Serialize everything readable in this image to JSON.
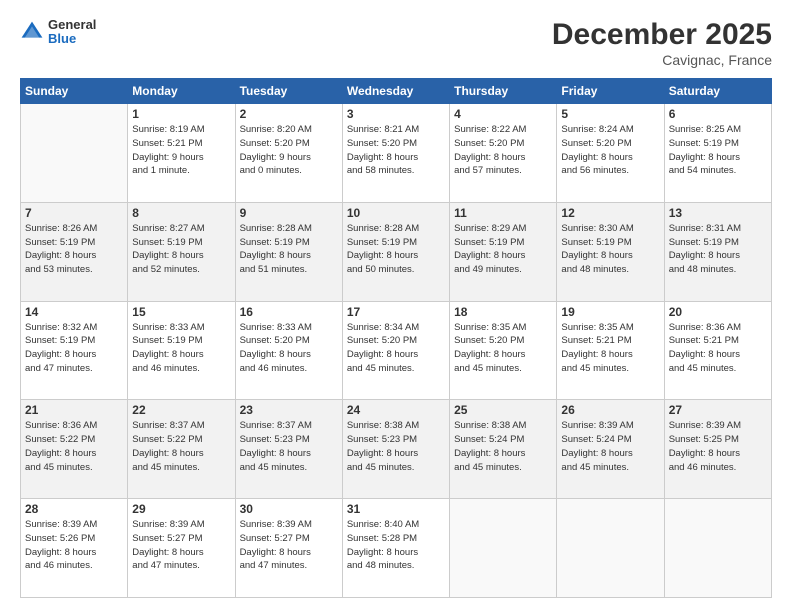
{
  "header": {
    "logo_general": "General",
    "logo_blue": "Blue",
    "main_title": "December 2025",
    "subtitle": "Cavignac, France"
  },
  "weekdays": [
    "Sunday",
    "Monday",
    "Tuesday",
    "Wednesday",
    "Thursday",
    "Friday",
    "Saturday"
  ],
  "weeks": [
    [
      {
        "day": "",
        "info": ""
      },
      {
        "day": "1",
        "info": "Sunrise: 8:19 AM\nSunset: 5:21 PM\nDaylight: 9 hours\nand 1 minute."
      },
      {
        "day": "2",
        "info": "Sunrise: 8:20 AM\nSunset: 5:20 PM\nDaylight: 9 hours\nand 0 minutes."
      },
      {
        "day": "3",
        "info": "Sunrise: 8:21 AM\nSunset: 5:20 PM\nDaylight: 8 hours\nand 58 minutes."
      },
      {
        "day": "4",
        "info": "Sunrise: 8:22 AM\nSunset: 5:20 PM\nDaylight: 8 hours\nand 57 minutes."
      },
      {
        "day": "5",
        "info": "Sunrise: 8:24 AM\nSunset: 5:20 PM\nDaylight: 8 hours\nand 56 minutes."
      },
      {
        "day": "6",
        "info": "Sunrise: 8:25 AM\nSunset: 5:19 PM\nDaylight: 8 hours\nand 54 minutes."
      }
    ],
    [
      {
        "day": "7",
        "info": "Sunrise: 8:26 AM\nSunset: 5:19 PM\nDaylight: 8 hours\nand 53 minutes."
      },
      {
        "day": "8",
        "info": "Sunrise: 8:27 AM\nSunset: 5:19 PM\nDaylight: 8 hours\nand 52 minutes."
      },
      {
        "day": "9",
        "info": "Sunrise: 8:28 AM\nSunset: 5:19 PM\nDaylight: 8 hours\nand 51 minutes."
      },
      {
        "day": "10",
        "info": "Sunrise: 8:28 AM\nSunset: 5:19 PM\nDaylight: 8 hours\nand 50 minutes."
      },
      {
        "day": "11",
        "info": "Sunrise: 8:29 AM\nSunset: 5:19 PM\nDaylight: 8 hours\nand 49 minutes."
      },
      {
        "day": "12",
        "info": "Sunrise: 8:30 AM\nSunset: 5:19 PM\nDaylight: 8 hours\nand 48 minutes."
      },
      {
        "day": "13",
        "info": "Sunrise: 8:31 AM\nSunset: 5:19 PM\nDaylight: 8 hours\nand 48 minutes."
      }
    ],
    [
      {
        "day": "14",
        "info": "Sunrise: 8:32 AM\nSunset: 5:19 PM\nDaylight: 8 hours\nand 47 minutes."
      },
      {
        "day": "15",
        "info": "Sunrise: 8:33 AM\nSunset: 5:19 PM\nDaylight: 8 hours\nand 46 minutes."
      },
      {
        "day": "16",
        "info": "Sunrise: 8:33 AM\nSunset: 5:20 PM\nDaylight: 8 hours\nand 46 minutes."
      },
      {
        "day": "17",
        "info": "Sunrise: 8:34 AM\nSunset: 5:20 PM\nDaylight: 8 hours\nand 45 minutes."
      },
      {
        "day": "18",
        "info": "Sunrise: 8:35 AM\nSunset: 5:20 PM\nDaylight: 8 hours\nand 45 minutes."
      },
      {
        "day": "19",
        "info": "Sunrise: 8:35 AM\nSunset: 5:21 PM\nDaylight: 8 hours\nand 45 minutes."
      },
      {
        "day": "20",
        "info": "Sunrise: 8:36 AM\nSunset: 5:21 PM\nDaylight: 8 hours\nand 45 minutes."
      }
    ],
    [
      {
        "day": "21",
        "info": "Sunrise: 8:36 AM\nSunset: 5:22 PM\nDaylight: 8 hours\nand 45 minutes."
      },
      {
        "day": "22",
        "info": "Sunrise: 8:37 AM\nSunset: 5:22 PM\nDaylight: 8 hours\nand 45 minutes."
      },
      {
        "day": "23",
        "info": "Sunrise: 8:37 AM\nSunset: 5:23 PM\nDaylight: 8 hours\nand 45 minutes."
      },
      {
        "day": "24",
        "info": "Sunrise: 8:38 AM\nSunset: 5:23 PM\nDaylight: 8 hours\nand 45 minutes."
      },
      {
        "day": "25",
        "info": "Sunrise: 8:38 AM\nSunset: 5:24 PM\nDaylight: 8 hours\nand 45 minutes."
      },
      {
        "day": "26",
        "info": "Sunrise: 8:39 AM\nSunset: 5:24 PM\nDaylight: 8 hours\nand 45 minutes."
      },
      {
        "day": "27",
        "info": "Sunrise: 8:39 AM\nSunset: 5:25 PM\nDaylight: 8 hours\nand 46 minutes."
      }
    ],
    [
      {
        "day": "28",
        "info": "Sunrise: 8:39 AM\nSunset: 5:26 PM\nDaylight: 8 hours\nand 46 minutes."
      },
      {
        "day": "29",
        "info": "Sunrise: 8:39 AM\nSunset: 5:27 PM\nDaylight: 8 hours\nand 47 minutes."
      },
      {
        "day": "30",
        "info": "Sunrise: 8:39 AM\nSunset: 5:27 PM\nDaylight: 8 hours\nand 47 minutes."
      },
      {
        "day": "31",
        "info": "Sunrise: 8:40 AM\nSunset: 5:28 PM\nDaylight: 8 hours\nand 48 minutes."
      },
      {
        "day": "",
        "info": ""
      },
      {
        "day": "",
        "info": ""
      },
      {
        "day": "",
        "info": ""
      }
    ]
  ]
}
